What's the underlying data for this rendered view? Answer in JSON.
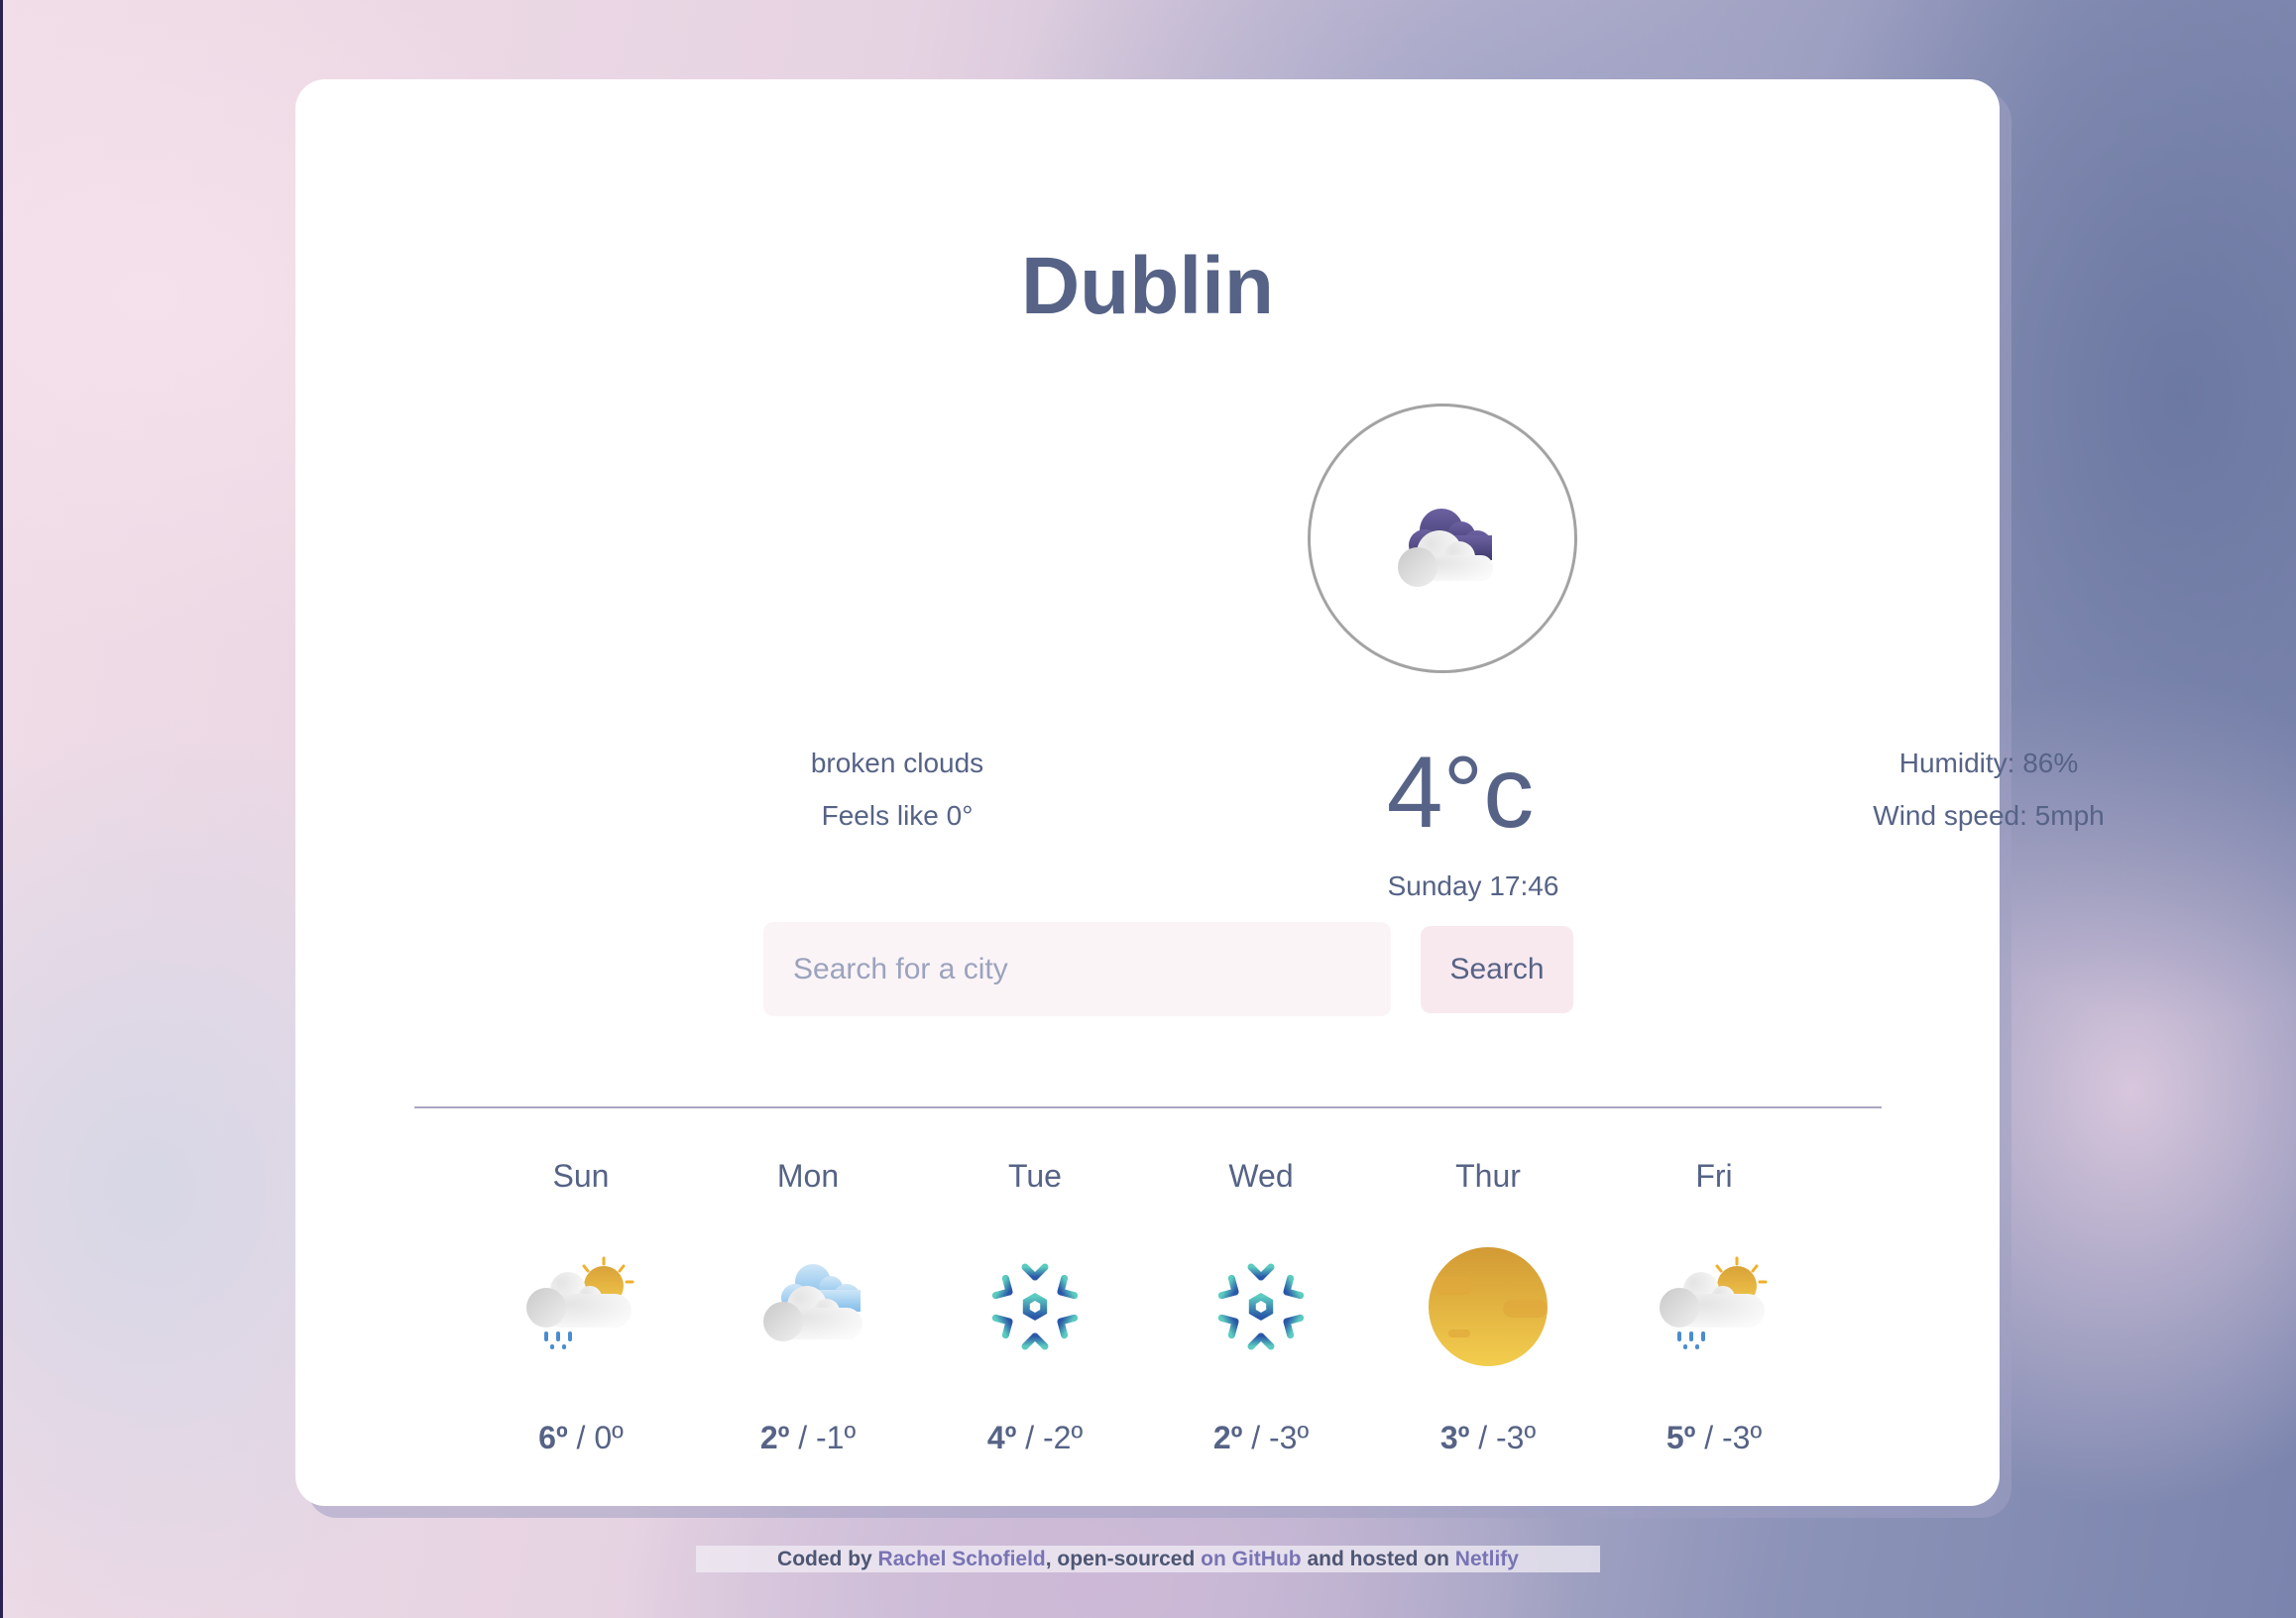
{
  "city": "Dublin",
  "current": {
    "icon": "broken-clouds-icon",
    "description": "broken clouds",
    "feels_like": "Feels like 0°",
    "temperature": "4°c",
    "datetime": "Sunday 17:46",
    "humidity": "Humidity: 86%",
    "wind_speed": "Wind speed: 5mph"
  },
  "search": {
    "placeholder": "Search for a city",
    "value": "",
    "button_label": "Search"
  },
  "forecast": [
    {
      "day": "Sun",
      "icon": "sun-cloud-rain-icon",
      "high": "6º",
      "low": "0º"
    },
    {
      "day": "Mon",
      "icon": "clouds-icon",
      "high": "2º",
      "low": "-1º"
    },
    {
      "day": "Tue",
      "icon": "snowflake-icon",
      "high": "4º",
      "low": "-2º"
    },
    {
      "day": "Wed",
      "icon": "snowflake-icon",
      "high": "2º",
      "low": "-3º"
    },
    {
      "day": "Thur",
      "icon": "haze-sun-icon",
      "high": "3º",
      "low": "-3º"
    },
    {
      "day": "Fri",
      "icon": "sun-cloud-rain-icon",
      "high": "5º",
      "low": "-3º"
    }
  ],
  "temp_separator": " / ",
  "footer": {
    "prefix": "Coded by ",
    "author": "Rachel Schofield",
    "middle": ", open-sourced ",
    "github": "on GitHub",
    "middle2": " and hosted on ",
    "netlify": "Netlify"
  },
  "colors": {
    "text": "#566386",
    "link": "#7874b4",
    "input_bg": "#fbf4f7",
    "button_bg": "#f8e9ef"
  }
}
